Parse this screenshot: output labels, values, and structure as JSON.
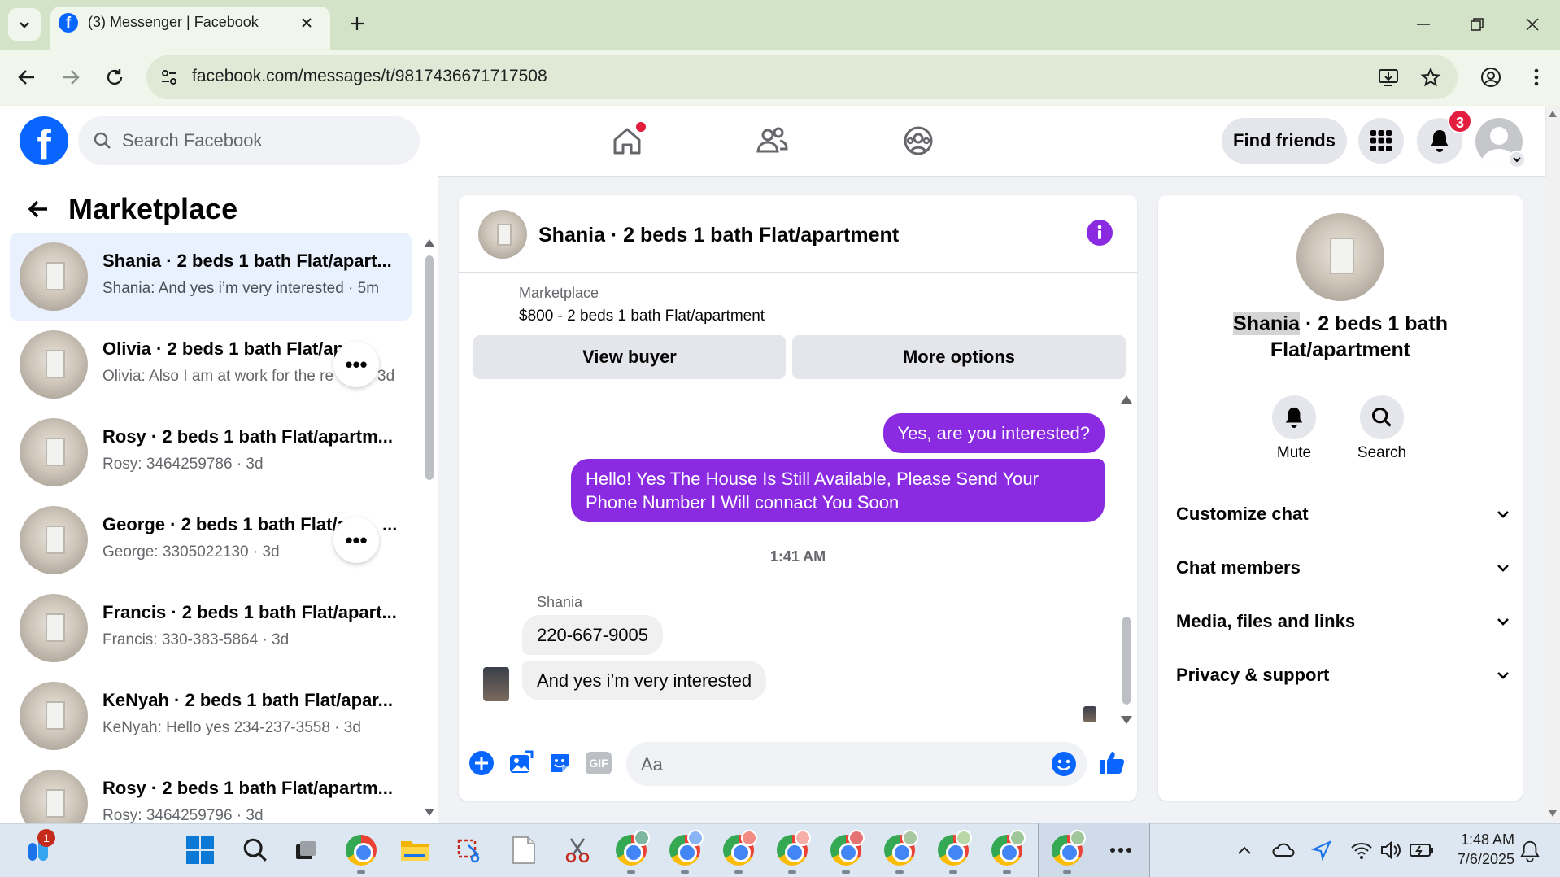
{
  "browser": {
    "tab_title": "(3) Messenger | Facebook",
    "url": "facebook.com/messages/t/9817436671717508"
  },
  "fb_header": {
    "search_placeholder": "Search Facebook",
    "find_friends": "Find friends",
    "notification_count": "3",
    "brand_color": "#0866ff"
  },
  "left": {
    "title": "Marketplace",
    "conversations": [
      {
        "title": "Shania · 2 beds 1 bath Flat/apart...",
        "subtitle": "Shania: And yes i’m very interested · 5m"
      },
      {
        "title": "Olivia · 2 beds 1 bath Flat/ap",
        "subtitle": "Olivia: Also I am at work for the re",
        "subtitle_tail": "3d"
      },
      {
        "title": "Rosy · 2 beds 1 bath Flat/apartm...",
        "subtitle": "Rosy: 3464259786 · 3d"
      },
      {
        "title": "George · 2 beds 1 bath Flat/a",
        "title_tail": "...",
        "subtitle": "George: 3305022130 · 3d"
      },
      {
        "title": "Francis · 2 beds 1 bath Flat/apart...",
        "subtitle": "Francis: 330-383-5864 · 3d"
      },
      {
        "title": "KeNyah · 2 beds 1 bath Flat/apar...",
        "subtitle": "KeNyah: Hello yes 234-237-3558 · 3d"
      },
      {
        "title": "Rosy · 2 beds 1 bath Flat/apartm...",
        "subtitle": "Rosy: 3464259796 · 3d"
      }
    ]
  },
  "chat": {
    "header_title": "Shania · 2 beds 1 bath Flat/apartment",
    "listing_source": "Marketplace",
    "listing_text": "$800 - 2 beds 1 bath Flat/apartment",
    "view_buyer": "View buyer",
    "more_options": "More options",
    "messages_out": [
      "Yes, are you interested?",
      "Hello! Yes The House  Is Still Available, Please Send Your Phone Number I Will connact You Soon"
    ],
    "timestamp": "1:41 AM",
    "sender_name": "Shania",
    "messages_in": [
      "220-667-9005",
      "And  yes i’m very interested"
    ],
    "composer_placeholder": "Aa",
    "accent_color": "#8a2be2"
  },
  "info": {
    "name_highlight": "Shania",
    "name_rest": " · 2 beds 1 bath",
    "name_line2": "Flat/apartment",
    "mute": "Mute",
    "search": "Search",
    "sections": [
      "Customize chat",
      "Chat members",
      "Media, files and links",
      "Privacy & support"
    ]
  },
  "taskbar": {
    "start_badge": "1",
    "time": "1:48 AM",
    "date": "7/6/2025"
  }
}
